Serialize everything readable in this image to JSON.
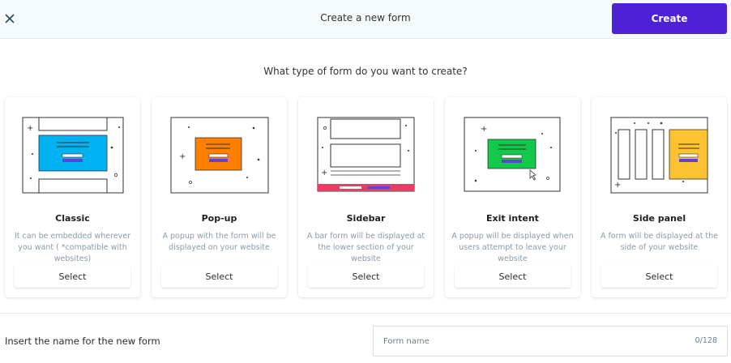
{
  "header": {
    "title": "Create a new form",
    "create_label": "Create",
    "close_icon": "close-icon"
  },
  "question": "What type of form do you want to create?",
  "cards": [
    {
      "name": "Classic",
      "desc": "It can be embedded wherever you want ( *compatible with websites)",
      "select": "Select"
    },
    {
      "name": "Pop-up",
      "desc": "A popup with the form will be displayed on your website",
      "select": "Select"
    },
    {
      "name": "Sidebar",
      "desc": "A bar form will be displayed at the lower section of your website",
      "select": "Select"
    },
    {
      "name": "Exit intent",
      "desc": "A popup will be displayed when users attempt to leave your website",
      "select": "Select"
    },
    {
      "name": "Side panel",
      "desc": "A form will be displayed at the side of your website",
      "select": "Select"
    }
  ],
  "form_name": {
    "label": "Insert the name for the new form",
    "placeholder": "Form name",
    "counter": "0/128"
  },
  "colors": {
    "accent": "#4d21d6",
    "classic": "#00b2f0",
    "popup": "#ff7f00",
    "sidebar": "#ef3a66",
    "exit": "#12c94a",
    "panel": "#ffc233",
    "bars": "#5a45d8"
  }
}
